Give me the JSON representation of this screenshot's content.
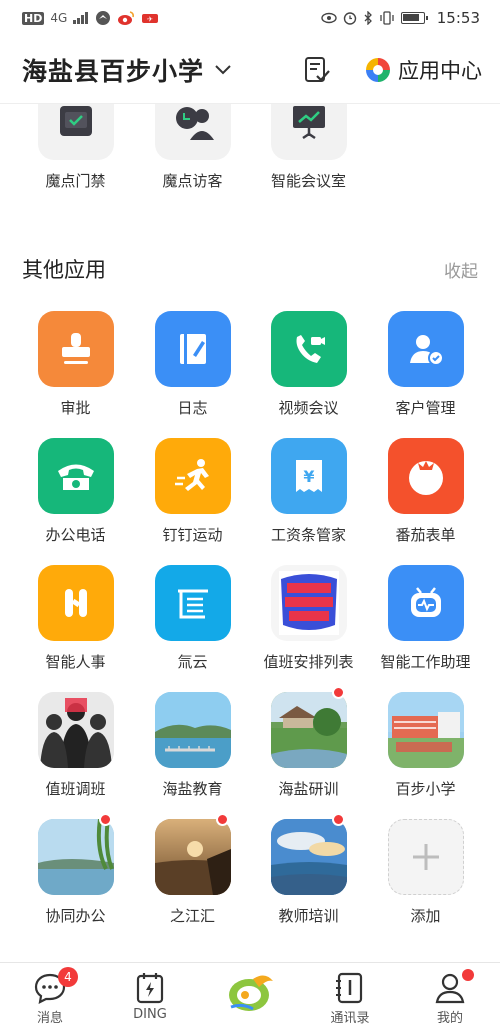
{
  "status_bar": {
    "left_icons": [
      "HD",
      "4G",
      "signal-icon",
      "bird-app-icon",
      "weibo-icon",
      "ticket-app-icon"
    ],
    "right_icons": [
      "eye-icon",
      "alarm-icon",
      "bluetooth-icon",
      "vibrate-icon",
      "battery-icon"
    ],
    "time": "15:53"
  },
  "header": {
    "org_title": "海盐县百步小学",
    "app_center_label": "应用中心"
  },
  "top_apps": [
    {
      "label": "魔点门禁",
      "icon": "door-access-icon"
    },
    {
      "label": "魔点访客",
      "icon": "visitor-icon"
    },
    {
      "label": "智能会议室",
      "icon": "meeting-room-icon"
    }
  ],
  "other_apps": {
    "title": "其他应用",
    "collapse_label": "收起",
    "items": [
      {
        "label": "审批",
        "icon": "stamp-icon",
        "color": "#f5893a"
      },
      {
        "label": "日志",
        "icon": "journal-icon",
        "color": "#3b8ff6"
      },
      {
        "label": "视频会议",
        "icon": "video-call-icon",
        "color": "#16b77a"
      },
      {
        "label": "客户管理",
        "icon": "customer-icon",
        "color": "#3b8ff6"
      },
      {
        "label": "办公电话",
        "icon": "phone-icon",
        "color": "#16b77a"
      },
      {
        "label": "钉钉运动",
        "icon": "runner-icon",
        "color": "#ffaa0a"
      },
      {
        "label": "工资条管家",
        "icon": "payslip-icon",
        "color": "#3fa7f0"
      },
      {
        "label": "番茄表单",
        "icon": "tomato-icon",
        "color": "#f4512c"
      },
      {
        "label": "智能人事",
        "icon": "hr-icon",
        "color": "#ffaa0a"
      },
      {
        "label": "氚云",
        "icon": "cloud-app-icon",
        "color": "#13a9e8"
      },
      {
        "label": "值班安排列表",
        "icon": "duty-list-icon",
        "color": "#f5f5f5"
      },
      {
        "label": "智能工作助理",
        "icon": "robot-icon",
        "color": "#3b8ff6"
      },
      {
        "label": "值班调班",
        "icon": "people-icon",
        "color": "#f0f0f0"
      },
      {
        "label": "海盐教育",
        "icon": "lake-photo-icon",
        "color": "#7fc4ec"
      },
      {
        "label": "海盐研训",
        "icon": "garden-photo-icon",
        "color": "#6a9e58",
        "dot": true
      },
      {
        "label": "百步小学",
        "icon": "school-photo-icon",
        "color": "#9fd0f0"
      },
      {
        "label": "协同办公",
        "icon": "willow-photo-icon",
        "color": "#8cc3e0",
        "dot": true
      },
      {
        "label": "之江汇",
        "icon": "sunset-photo-icon",
        "color": "#a07845",
        "dot": true
      },
      {
        "label": "教师培训",
        "icon": "sky-photo-icon",
        "color": "#4c8fd0",
        "dot": true
      },
      {
        "label": "添加",
        "icon": "plus-icon",
        "color": "#f4f4f4"
      }
    ]
  },
  "tabbar": {
    "items": [
      {
        "label": "消息",
        "badge": "4"
      },
      {
        "label": "DING"
      },
      {
        "label": ""
      },
      {
        "label": "通讯录"
      },
      {
        "label": "我的"
      }
    ]
  }
}
